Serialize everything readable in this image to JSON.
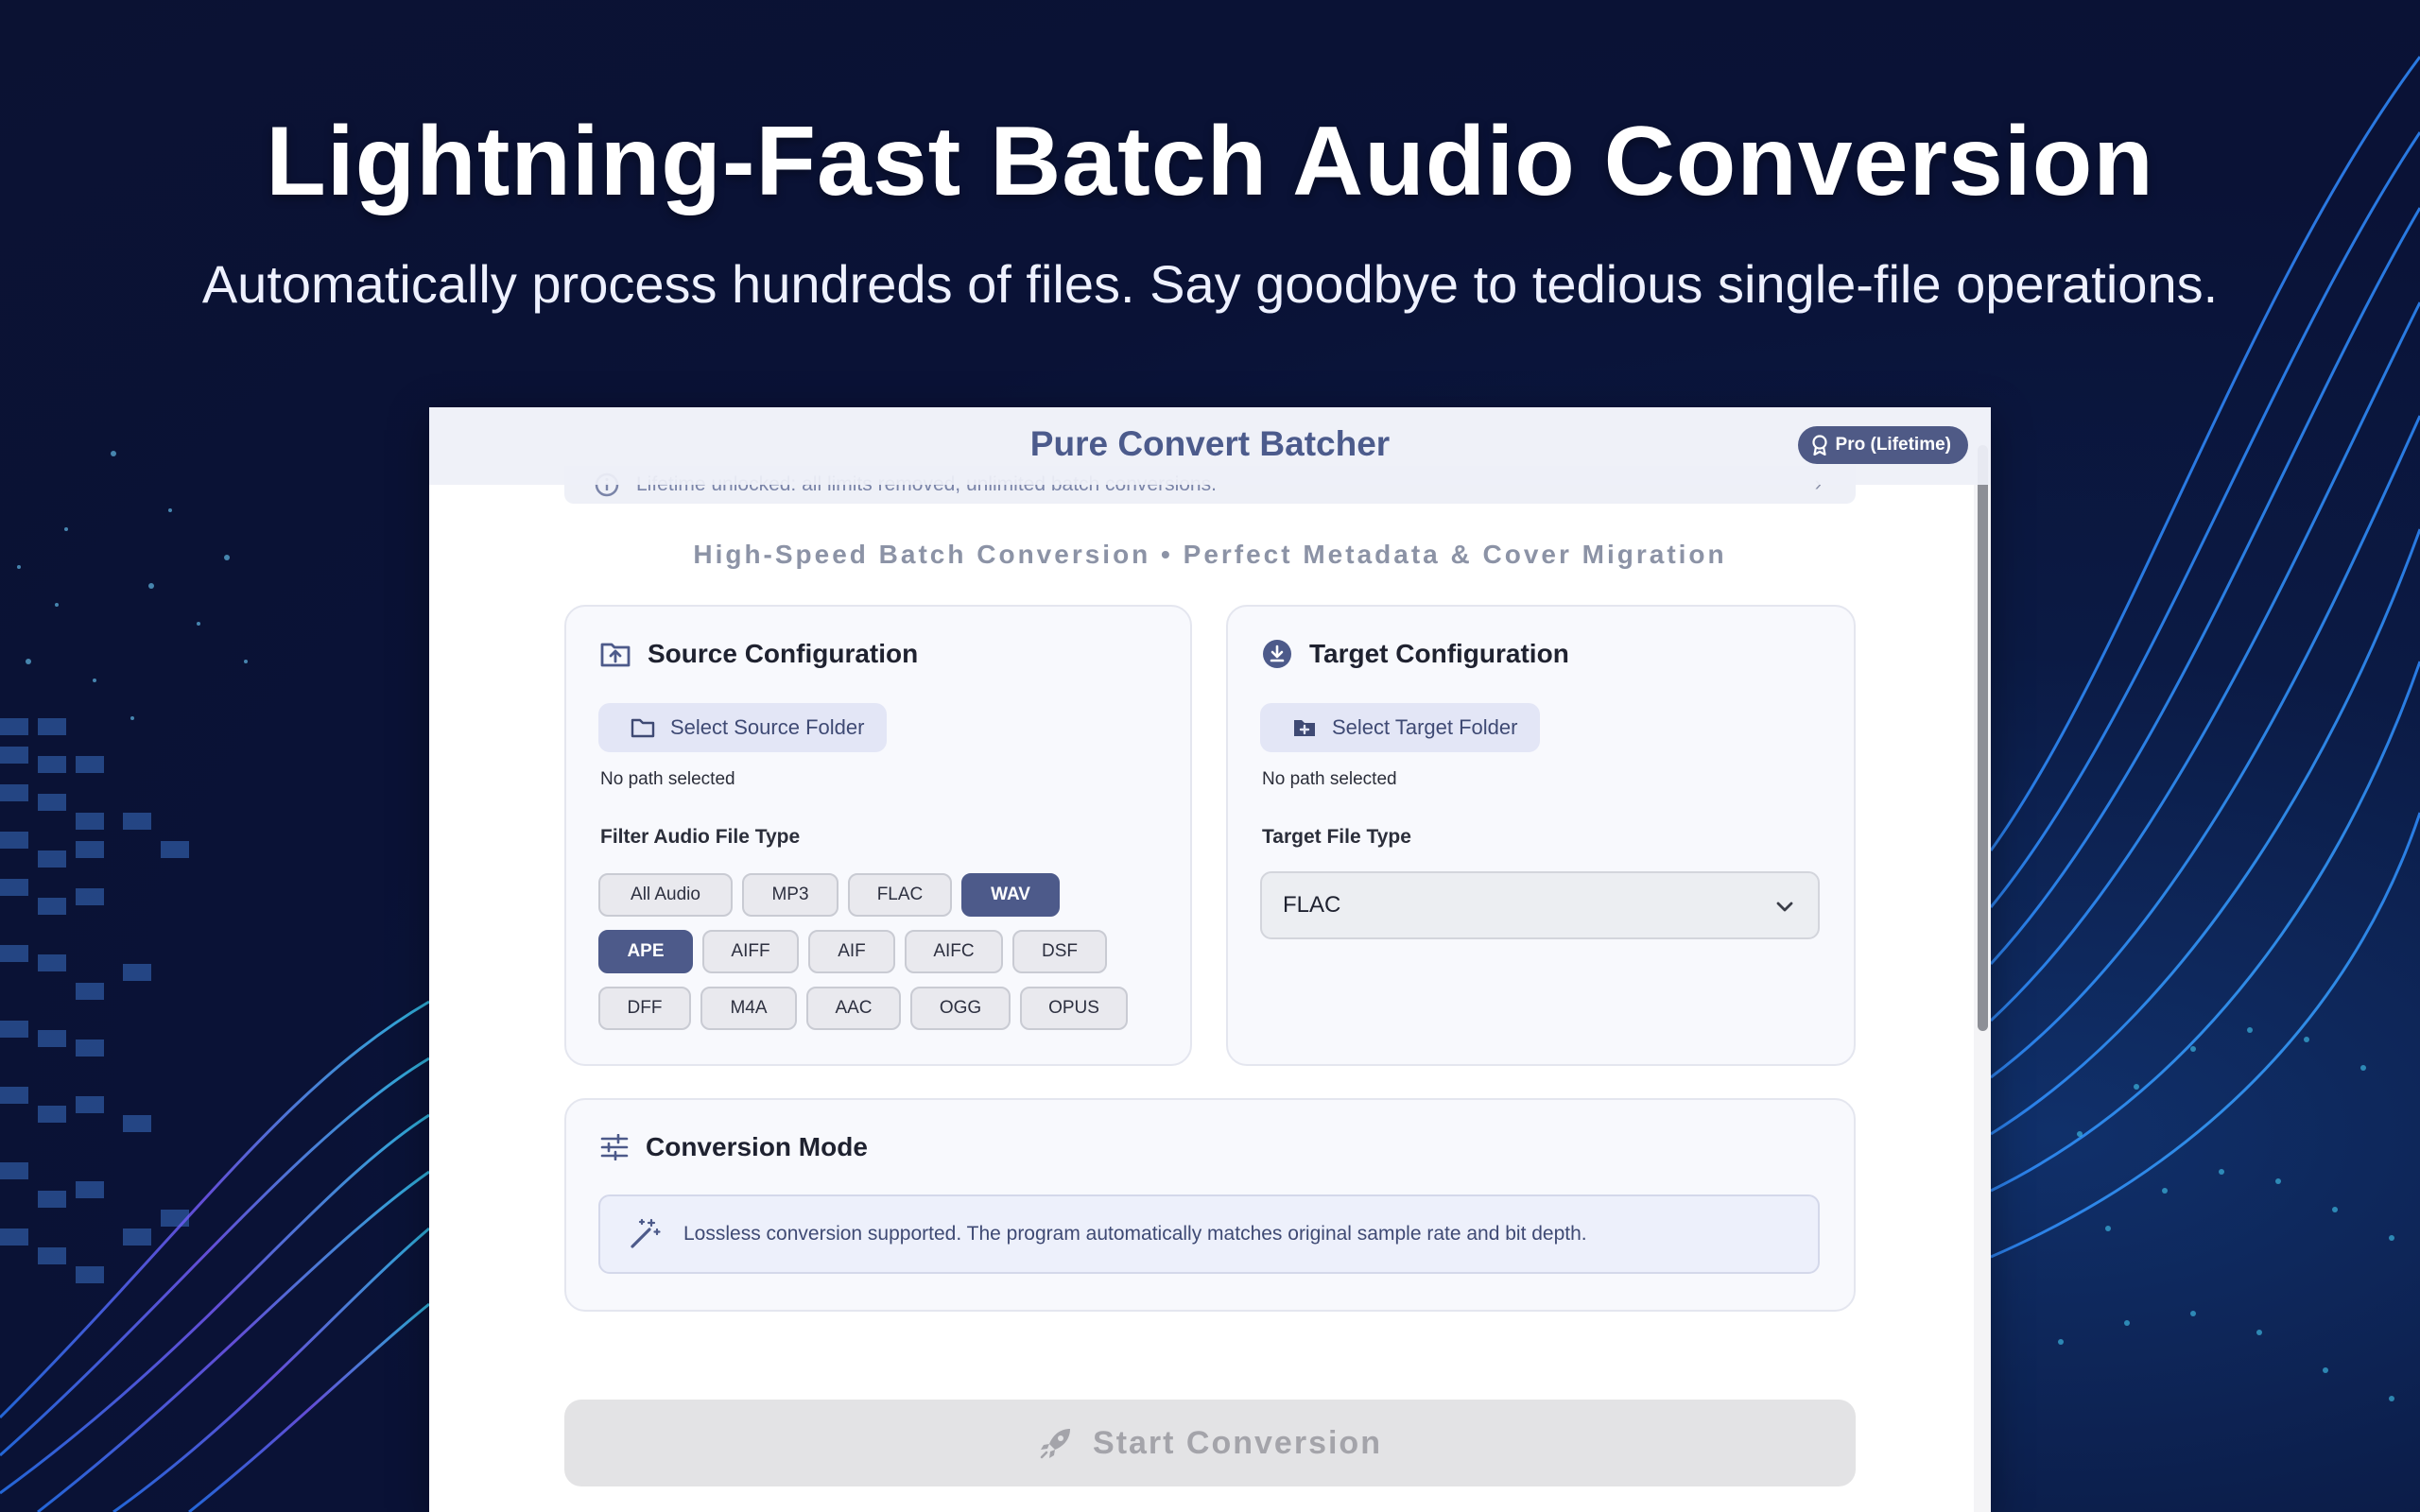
{
  "hero": {
    "title": "Lightning-Fast Batch Audio Conversion",
    "subtitle": "Automatically process hundreds of files. Say goodbye to tedious single-file operations."
  },
  "app": {
    "title": "Pure Convert Batcher",
    "badge": "Pro (Lifetime)",
    "notice": "Lifetime unlocked: all limits removed, unlimited batch conversions.",
    "tagline": "High-Speed Batch Conversion • Perfect Metadata & Cover Migration"
  },
  "source": {
    "title": "Source Configuration",
    "button_label": "Select Source Folder",
    "path": "No path selected",
    "filter_label": "Filter Audio File Type",
    "types": [
      {
        "label": "All Audio",
        "active": false
      },
      {
        "label": "MP3",
        "active": false
      },
      {
        "label": "FLAC",
        "active": false
      },
      {
        "label": "WAV",
        "active": true
      },
      {
        "label": "APE",
        "active": true
      },
      {
        "label": "AIFF",
        "active": false
      },
      {
        "label": "AIF",
        "active": false
      },
      {
        "label": "AIFC",
        "active": false
      },
      {
        "label": "DSF",
        "active": false
      },
      {
        "label": "DFF",
        "active": false
      },
      {
        "label": "M4A",
        "active": false
      },
      {
        "label": "AAC",
        "active": false
      },
      {
        "label": "OGG",
        "active": false
      },
      {
        "label": "OPUS",
        "active": false
      }
    ]
  },
  "target": {
    "title": "Target Configuration",
    "button_label": "Select Target Folder",
    "path": "No path selected",
    "type_label": "Target File Type",
    "selected_type": "FLAC"
  },
  "mode": {
    "title": "Conversion Mode",
    "info": "Lossless conversion supported. The program automatically matches original sample rate and bit depth."
  },
  "start_button": "Start Conversion",
  "colors": {
    "accent": "#4d5a8a",
    "badge": "#4f5a86",
    "hero_text": "#ffffff"
  }
}
